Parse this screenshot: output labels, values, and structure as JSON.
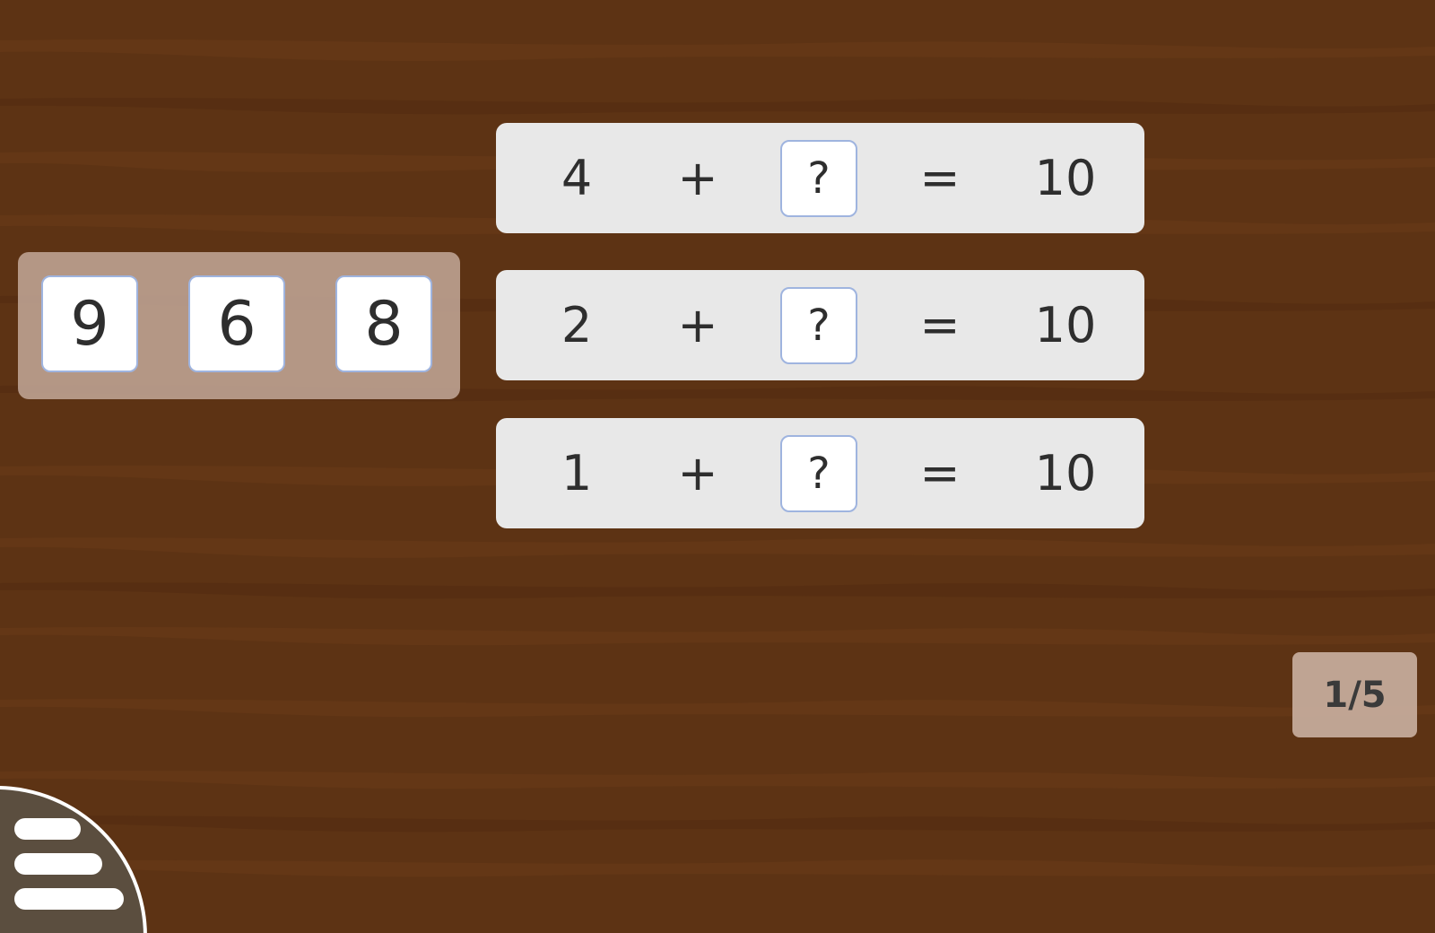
{
  "tray": {
    "tiles": [
      "9",
      "6",
      "8"
    ]
  },
  "equations": [
    {
      "a": "4",
      "op": "+",
      "slot": "?",
      "eq": "=",
      "result": "10"
    },
    {
      "a": "2",
      "op": "+",
      "slot": "?",
      "eq": "=",
      "result": "10"
    },
    {
      "a": "1",
      "op": "+",
      "slot": "?",
      "eq": "=",
      "result": "10"
    }
  ],
  "progress": {
    "label": "1/5",
    "current": 1,
    "total": 5
  },
  "menu": {
    "icon": "menu-icon"
  },
  "colors": {
    "background": "#5d3314",
    "card": "#e8e8e8",
    "tile_border": "#9fb4df",
    "menu": "#5b4e3f"
  }
}
